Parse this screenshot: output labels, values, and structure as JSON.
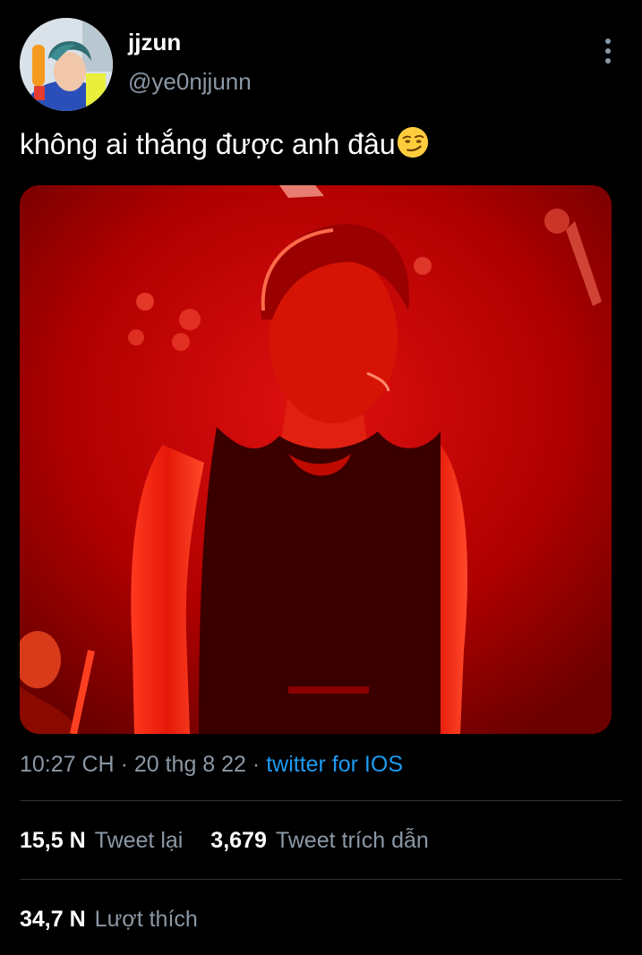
{
  "user": {
    "display_name": "jjzun",
    "handle": "@ye0njjunn"
  },
  "tweet": {
    "text": "không ai thắng được anh đâu",
    "emoji": "smirking-face-emoji"
  },
  "meta": {
    "time": "10:27 CH",
    "separator": " · ",
    "date": "20 thg 8 22",
    "source": "twitter for IOS"
  },
  "stats": {
    "retweets_count": "15,5 N",
    "retweets_label": "Tweet lại",
    "quotes_count": "3,679",
    "quotes_label": "Tweet trích dẫn",
    "likes_count": "34,7 N",
    "likes_label": "Lượt thích"
  },
  "colors": {
    "background": "#000000",
    "text_primary": "#ffffff",
    "text_secondary": "#8b98a5",
    "link": "#1d9bf0",
    "divider": "#2f3336",
    "photo_tint": "#d40000"
  },
  "icons": {
    "more": "more-vertical-icon"
  }
}
